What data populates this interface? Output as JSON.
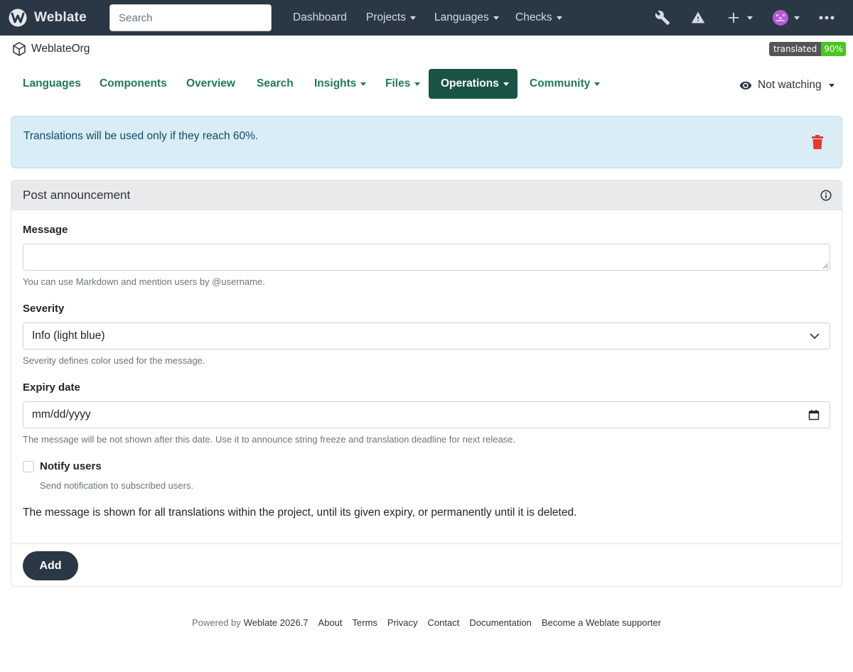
{
  "topbar": {
    "brand": "Weblate",
    "search_placeholder": "Search",
    "nav": [
      "Dashboard",
      "Projects",
      "Languages",
      "Checks"
    ]
  },
  "breadcrumb": {
    "project": "WeblateOrg",
    "badge_label": "translated",
    "badge_value": "90%"
  },
  "subnav": {
    "items": [
      "Languages",
      "Components",
      "Overview",
      "Search",
      "Insights",
      "Files",
      "Operations",
      "Community"
    ],
    "active": "Operations",
    "watch_label": "Not watching"
  },
  "alert": {
    "text": "Translations will be used only if they reach 60%."
  },
  "form": {
    "title": "Post announcement",
    "message_label": "Message",
    "message_value": "",
    "message_hint": "You can use Markdown and mention users by @username.",
    "severity_label": "Severity",
    "severity_value": "Info (light blue)",
    "severity_hint": "Severity defines color used for the message.",
    "expiry_label": "Expiry date",
    "expiry_value": "mm/dd/yyyy",
    "expiry_hint": "The message will be not shown after this date. Use it to announce string freeze and translation deadline for next release.",
    "notify_label": "Notify users",
    "notify_checked": false,
    "notify_hint": "Send notification to subscribed users.",
    "note": "The message is shown for all translations within the project, until its given expiry, or permanently until it is deleted.",
    "submit_label": "Add"
  },
  "footer": {
    "powered_by": "Powered by",
    "version": "Weblate 2026.7",
    "links": [
      "About",
      "Terms",
      "Privacy",
      "Contact",
      "Documentation",
      "Become a Weblate supporter"
    ]
  },
  "colors": {
    "navbar": "#2a3744",
    "accent": "#1f7a52",
    "active_tab": "#1a5444",
    "alert_bg": "#daedf6",
    "danger": "#e03c31",
    "badge_green": "#4bc51d"
  }
}
